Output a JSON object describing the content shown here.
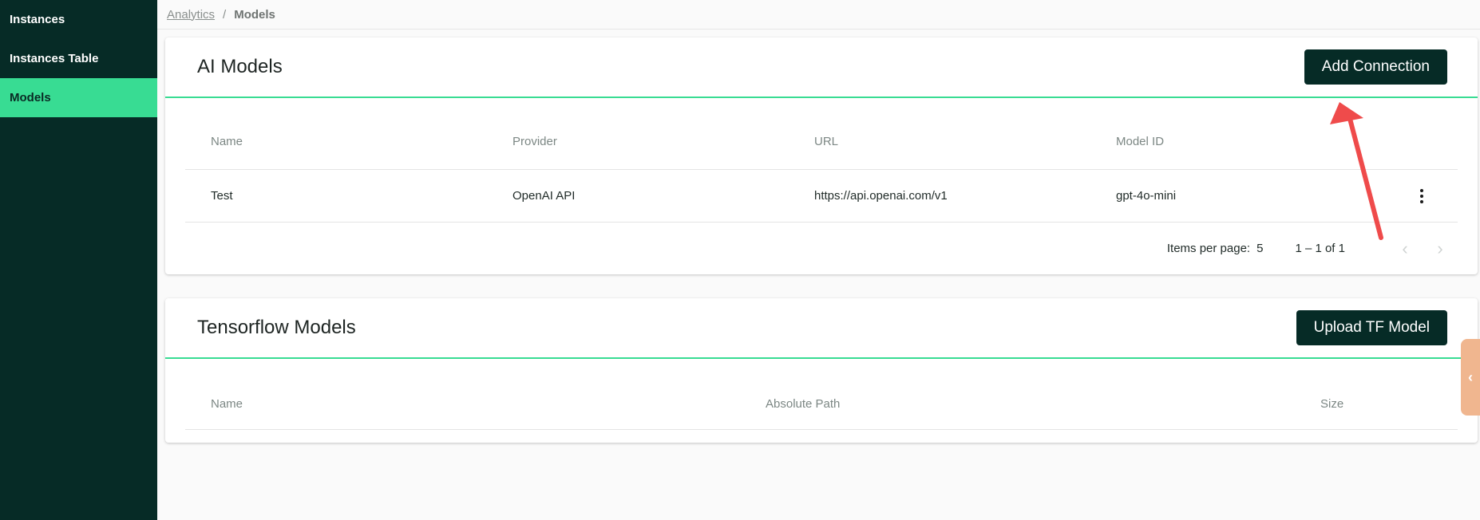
{
  "sidebar": {
    "items": [
      {
        "label": "Instances"
      },
      {
        "label": "Instances Table"
      },
      {
        "label": "Models"
      }
    ]
  },
  "breadcrumb": {
    "parent": "Analytics",
    "separator": "/",
    "current": "Models"
  },
  "ai_models": {
    "title": "AI Models",
    "button": "Add Connection",
    "columns": [
      "Name",
      "Provider",
      "URL",
      "Model ID"
    ],
    "rows": [
      {
        "name": "Test",
        "provider": "OpenAI API",
        "url": "https://api.openai.com/v1",
        "model_id": "gpt-4o-mini"
      }
    ],
    "paginator": {
      "items_per_page_label": "Items per page:",
      "items_per_page": "5",
      "range": "1 – 1 of 1"
    }
  },
  "tf_models": {
    "title": "Tensorflow Models",
    "button": "Upload TF Model",
    "columns": [
      "Name",
      "Absolute Path",
      "Size"
    ]
  },
  "colors": {
    "sidebar": "#062b26",
    "accent": "#38dc93",
    "button": "#062b26",
    "annotation_arrow": "#ef4b4b",
    "side_tab": "#f0b68f"
  },
  "icons": {
    "row_menu": "kebab-vertical-icon",
    "prev": "chevron-left-icon",
    "next": "chevron-right-icon",
    "side_tab": "chevron-left-icon"
  }
}
